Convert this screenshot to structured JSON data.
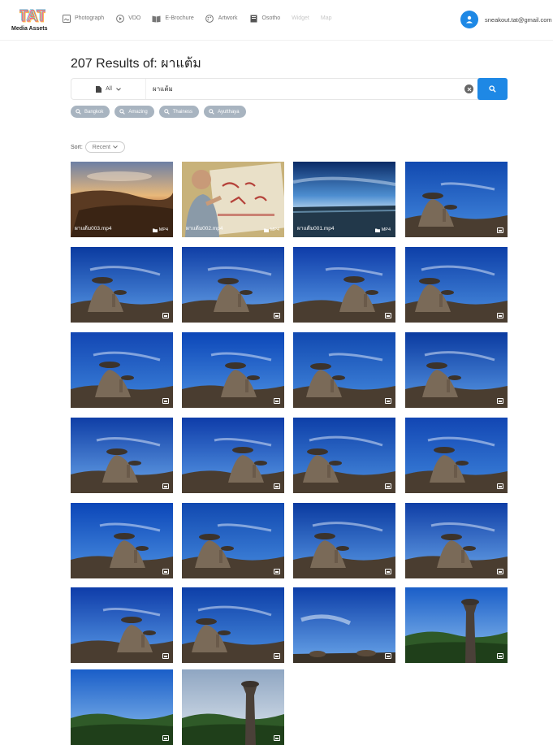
{
  "header": {
    "logo_text": "TAT",
    "logo_sub": "Media Assets",
    "nav": [
      {
        "label": "Photograph",
        "icon": "image-icon",
        "dim": false
      },
      {
        "label": "VDO",
        "icon": "play-circle-icon",
        "dim": false
      },
      {
        "label": "E-Brochure",
        "icon": "book-icon",
        "dim": false
      },
      {
        "label": "Artwork",
        "icon": "palette-icon",
        "dim": false
      },
      {
        "label": "Osotho",
        "icon": "document-icon",
        "dim": false
      },
      {
        "label": "Widget",
        "icon": "",
        "dim": true
      },
      {
        "label": "Map",
        "icon": "",
        "dim": true
      }
    ],
    "user_email": "sneakout.tat@gmail.com"
  },
  "results": {
    "count_title": "207 Results of: ผาแต้ม"
  },
  "search": {
    "filter_label": "All",
    "query": "ผาแต้ม"
  },
  "chips": [
    "Bangkok",
    "Amazing",
    "Thainess",
    "Ayutthaya"
  ],
  "sort": {
    "label": "Sort:",
    "value": "Recent"
  },
  "tiles": [
    {
      "caption": "ผาแต้ม003.mp4",
      "type": "MP4",
      "scene": "sunset"
    },
    {
      "caption": "ผาแต้ม002.mp4",
      "type": "MP4",
      "scene": "painting"
    },
    {
      "caption": "ผาแต้ม001.mp4",
      "type": "MP4",
      "scene": "dusk"
    },
    {
      "caption": "",
      "type": "photo",
      "scene": "rock"
    },
    {
      "caption": "",
      "type": "photo",
      "scene": "rock"
    },
    {
      "caption": "",
      "type": "photo",
      "scene": "rock"
    },
    {
      "caption": "",
      "type": "photo",
      "scene": "rock"
    },
    {
      "caption": "",
      "type": "photo",
      "scene": "rock"
    },
    {
      "caption": "",
      "type": "photo",
      "scene": "rock"
    },
    {
      "caption": "",
      "type": "photo",
      "scene": "rock"
    },
    {
      "caption": "",
      "type": "photo",
      "scene": "rock"
    },
    {
      "caption": "",
      "type": "photo",
      "scene": "rock"
    },
    {
      "caption": "",
      "type": "photo",
      "scene": "rock"
    },
    {
      "caption": "",
      "type": "photo",
      "scene": "rock"
    },
    {
      "caption": "",
      "type": "photo",
      "scene": "rock"
    },
    {
      "caption": "",
      "type": "photo",
      "scene": "rock"
    },
    {
      "caption": "",
      "type": "photo",
      "scene": "rock"
    },
    {
      "caption": "",
      "type": "photo",
      "scene": "rock"
    },
    {
      "caption": "",
      "type": "photo",
      "scene": "rock"
    },
    {
      "caption": "",
      "type": "photo",
      "scene": "rock"
    },
    {
      "caption": "",
      "type": "photo",
      "scene": "rock"
    },
    {
      "caption": "",
      "type": "photo",
      "scene": "rock"
    },
    {
      "caption": "",
      "type": "photo",
      "scene": "sky"
    },
    {
      "caption": "",
      "type": "photo",
      "scene": "pillar"
    },
    {
      "caption": "",
      "type": "photo",
      "scene": "forest"
    },
    {
      "caption": "",
      "type": "photo",
      "scene": "pillar2"
    }
  ],
  "colors": {
    "accent": "#1e88e5",
    "chip": "#a8b4c0"
  }
}
